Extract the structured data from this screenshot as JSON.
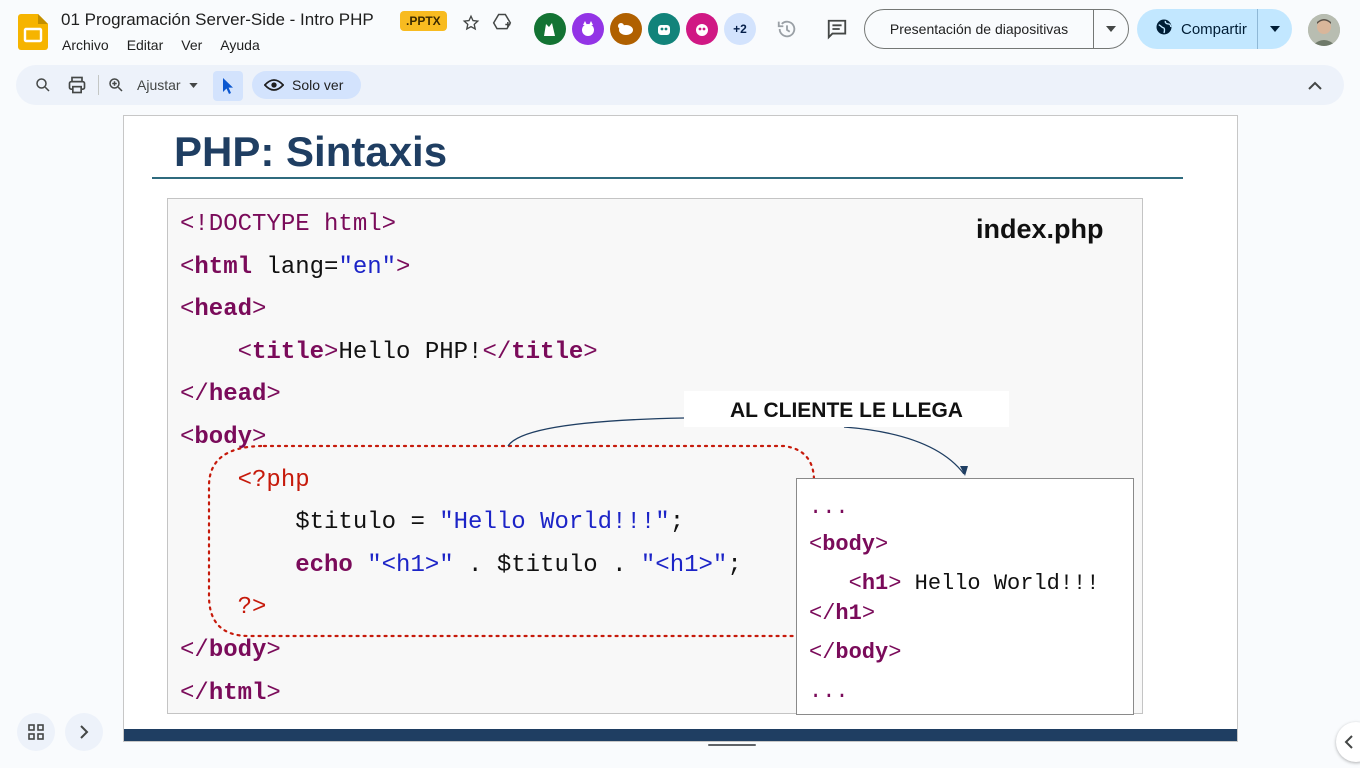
{
  "window": {
    "doc_title": "01 Programación Server-Side - Intro PHP",
    "file_badge": ".PPTX",
    "menu": [
      "Archivo",
      "Editar",
      "Ver",
      "Ayuda"
    ],
    "collaborators_more": "+2",
    "present_label": "Presentación de diapositivas",
    "share_label": "Compartir"
  },
  "toolbar": {
    "zoom_label": "Ajustar",
    "view_mode_label": "Solo ver"
  },
  "slide": {
    "title": "PHP: Sintaxis",
    "file_label": "index.php",
    "client_label": "AL CLIENTE LE LLEGA",
    "code": {
      "l1": "<!DOCTYPE html>",
      "l2_tag_open": "<",
      "l2_tag": "html",
      "l2_attr": " lang=",
      "l2_val": "\"en\"",
      "l2_close": ">",
      "l3": "head",
      "l4_title_text": "Hello PHP!",
      "l4_tag": "title",
      "l5": "head",
      "l6": "body",
      "l7": "<?php",
      "l8_var": "$titulo = ",
      "l8_str": "\"Hello World!!!\"",
      "l8_end": ";",
      "l9_kw": "echo",
      "l9_s1": "\"<h1>\"",
      "l9_mid": " . $titulo . ",
      "l9_s2": "\"<h1>\"",
      "l9_end": ";",
      "l10": "?>",
      "l11": "body",
      "l12": "html"
    },
    "output": {
      "dots_top": "...",
      "body_open": "body",
      "h1_open": "h1",
      "h1_text": " Hello World!!!",
      "h1_close": "h1",
      "body_close": "body",
      "dots_bottom": "..."
    }
  }
}
